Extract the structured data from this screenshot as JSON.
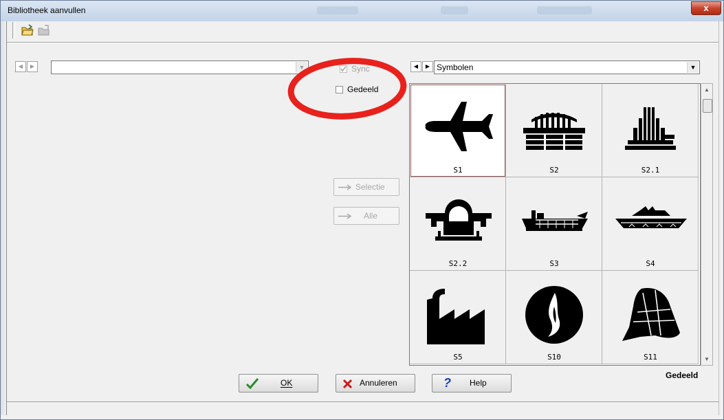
{
  "window": {
    "title": "Bibliotheek aanvullen",
    "close_glyph": "x"
  },
  "toolbar": {
    "icons": [
      "open-folder-icon",
      "folder-disabled-icon"
    ]
  },
  "left_panel": {
    "nav_prev": "◀",
    "nav_next": "▶",
    "combo_value": ""
  },
  "middle": {
    "sync_label": "Sync",
    "sync_checked": true,
    "shared_label": "Gedeeld",
    "shared_checked": false,
    "selection_button": "Selectie",
    "all_button": "Alle"
  },
  "right_panel": {
    "nav_prev": "◀",
    "nav_next": "▶",
    "combo_value": "Symbolen"
  },
  "symbols": [
    {
      "code": "S1",
      "icon": "airplane-icon",
      "selected": true
    },
    {
      "code": "S2",
      "icon": "stadium-icon",
      "selected": false
    },
    {
      "code": "S2.1",
      "icon": "columns-building-icon",
      "selected": false
    },
    {
      "code": "S2.2",
      "icon": "arch-icon",
      "selected": false
    },
    {
      "code": "S3",
      "icon": "cargo-ship-icon",
      "selected": false
    },
    {
      "code": "S4",
      "icon": "passenger-ship-icon",
      "selected": false
    },
    {
      "code": "S5",
      "icon": "factory-icon",
      "selected": false
    },
    {
      "code": "S10",
      "icon": "flame-emblem-icon",
      "selected": false
    },
    {
      "code": "S11",
      "icon": "helmet-icon",
      "selected": false
    }
  ],
  "footer": {
    "ok": "OK",
    "cancel": "Annuleren",
    "help": "Help",
    "shared_status": "Gedeeld"
  },
  "colors": {
    "highlight_ellipse": "#e8211d",
    "ok_check": "#2a8a2a",
    "cancel_x": "#cc1a1a",
    "help_q": "#1a3fb5"
  }
}
